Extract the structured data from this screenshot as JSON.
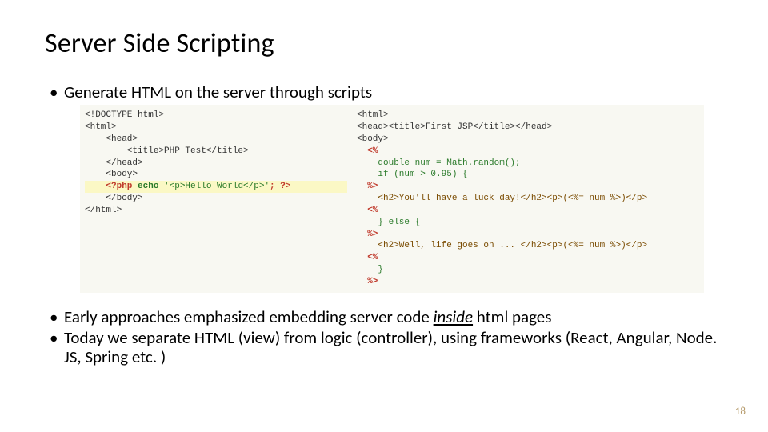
{
  "title": "Server Side Scripting",
  "bullets": {
    "b1": "Generate HTML on the server through scripts",
    "b2_pre": "Early approaches emphasized embedding server code ",
    "b2_em": "inside",
    "b2_post": " html pages",
    "b3": "Today we separate HTML (view) from logic (controller), using frameworks (React, Angular, Node. JS, Spring etc. )"
  },
  "code_left": {
    "l1": "<!DOCTYPE html>",
    "l2": "<html>",
    "l3": "    <head>",
    "l4": "        <title>PHP Test</title>",
    "l5": "    </head>",
    "l6": "    <body>",
    "l7_open": "    <?php ",
    "l7_kw": "echo",
    "l7_str": " '<p>Hello World</p>'",
    "l7_close": "; ?>",
    "l8": "    </body>",
    "l9": "</html>"
  },
  "code_right": {
    "r1": "<html>",
    "r2": "<head><title>First JSP</title></head>",
    "r3": "<body>",
    "r4a": "  <%",
    "r4b": "    double num = Math.random();",
    "r4c": "    if (num > 0.95) {",
    "r4d": "  %>",
    "r5a_h2": "    <h2>You'll have a luck day!</h2>",
    "r5a_mid": "<p>(",
    "r5a_expr": "<%= num %>",
    "r5a_end": ")</p>",
    "r6a": "  <%",
    "r6b": "    } else {",
    "r6c": "  %>",
    "r7a_h2": "    <h2>Well, life goes on ... </h2>",
    "r7a_mid": "<p>(",
    "r7a_expr": "<%= num %>",
    "r7a_end": ")</p>",
    "r8a": "  <%",
    "r8b": "    }",
    "r8c": "  %>"
  },
  "page_number": "18"
}
